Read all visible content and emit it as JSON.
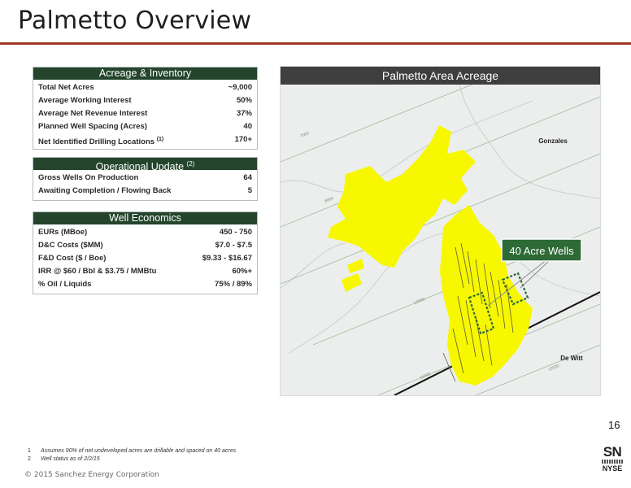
{
  "title": "Palmetto Overview",
  "acreage": {
    "header": "Acreage & Inventory",
    "rows": [
      {
        "label": "Total Net Acres",
        "value": "~9,000"
      },
      {
        "label": "Average Working Interest",
        "value": "50%"
      },
      {
        "label": "Average Net Revenue Interest",
        "value": "37%"
      },
      {
        "label": "Planned Well Spacing (Acres)",
        "value": "40"
      },
      {
        "label": "Net Identified Drilling Locations",
        "sup": "(1)",
        "value": "170+"
      }
    ]
  },
  "operational": {
    "header": "Operational Update",
    "header_sup": "(2)",
    "rows": [
      {
        "label": "Gross Wells On Production",
        "value": "64"
      },
      {
        "label": "Awaiting Completion / Flowing Back",
        "value": "5"
      }
    ]
  },
  "economics": {
    "header": "Well Economics",
    "rows": [
      {
        "label": "EURs (MBoe)",
        "value": "450 - 750"
      },
      {
        "label": "D&C Costs ($MM)",
        "value": "$7.0 - $7.5"
      },
      {
        "label": "F&D Cost ($ / Boe)",
        "value": "$9.33 - $16.67"
      },
      {
        "label": "IRR @ $60 / Bbl & $3.75 / MMBtu",
        "value": "60%+"
      },
      {
        "label": "% Oil / Liquids",
        "value": "75% / 89%"
      }
    ]
  },
  "map": {
    "header": "Palmetto Area Acreage",
    "callout": "40 Acre Wells",
    "county_gonzales": "Gonzales",
    "county_dewitt": "De Witt",
    "contours": [
      "7000",
      "8000",
      "9000",
      "10000",
      "11000",
      "12000"
    ],
    "acreage_color": "#f7f700",
    "callout_color": "#2d6a36"
  },
  "page_number": "16",
  "footnotes": [
    {
      "num": "1",
      "text": "Assumes 90% of net undeveloped acres are drillable and spaced on 40 acres"
    },
    {
      "num": "2",
      "text": "Well status as of 2/2/15"
    }
  ],
  "copyright": "© 2015 Sanchez Energy Corporation",
  "ticker": {
    "symbol": "SN",
    "exchange": "NYSE"
  }
}
